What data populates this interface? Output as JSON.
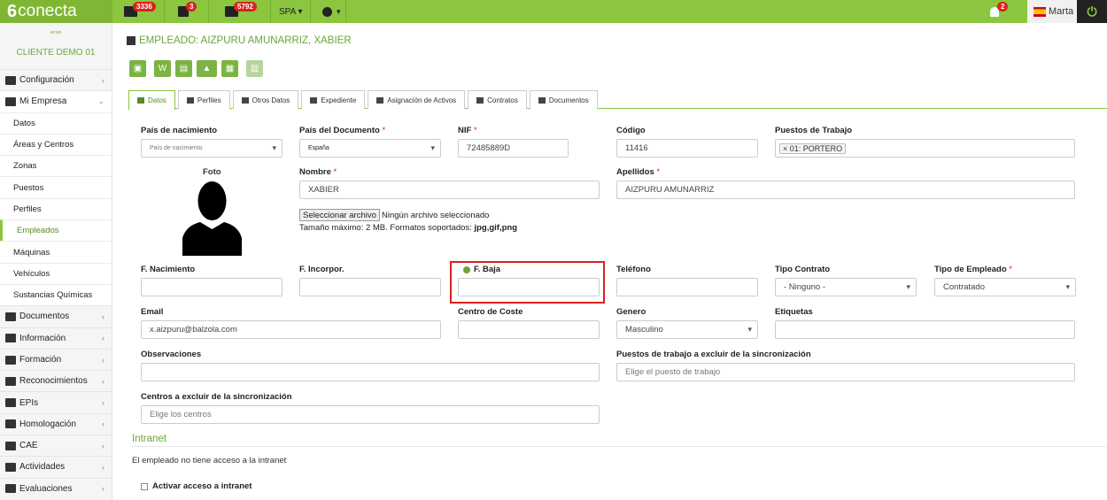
{
  "app": {
    "name": "conecta",
    "logo_mark": "6"
  },
  "topbar": {
    "mail_count": "3336",
    "calendar_count": "3",
    "tasks_count": "5792",
    "language": "SPA ▾",
    "help": "▾",
    "notifications_count": "2",
    "user_name": "Marta",
    "power": "⏻"
  },
  "sidebar": {
    "company_logo": "arrian",
    "client": "CLIENTE DEMO 01",
    "items": [
      {
        "label": "Configuración"
      },
      {
        "label": "Mi Empresa"
      },
      {
        "label": "Documentos"
      },
      {
        "label": "Información"
      },
      {
        "label": "Formación"
      },
      {
        "label": "Reconocimientos"
      },
      {
        "label": "EPIs"
      },
      {
        "label": "Homologación"
      },
      {
        "label": "CAE"
      },
      {
        "label": "Actividades"
      },
      {
        "label": "Evaluaciones"
      }
    ],
    "sub_items": [
      {
        "label": "Datos"
      },
      {
        "label": "Áreas y Centros"
      },
      {
        "label": "Zonas"
      },
      {
        "label": "Puestos"
      },
      {
        "label": "Perfiles"
      },
      {
        "label": "Empleados"
      },
      {
        "label": "Máquinas"
      },
      {
        "label": "Vehículos"
      },
      {
        "label": "Sustancias Químicas"
      }
    ]
  },
  "page": {
    "title": "EMPLEADO: AIZPURU AMUNARRIZ, XABIER"
  },
  "tabs": [
    {
      "label": "Datos"
    },
    {
      "label": "Perfiles"
    },
    {
      "label": "Otros Datos"
    },
    {
      "label": "Expediente"
    },
    {
      "label": "Asignación de Activos"
    },
    {
      "label": "Contratos"
    },
    {
      "label": "Documentos"
    }
  ],
  "form": {
    "pais_nacimiento": {
      "label": "País de nacimiento",
      "value": "País de nacimiento"
    },
    "pais_documento": {
      "label": "País del Documento",
      "value": "España"
    },
    "nif": {
      "label": "NIF",
      "value": "72485889D"
    },
    "codigo": {
      "label": "Código",
      "value": "11416"
    },
    "puestos": {
      "label": "Puestos de Trabajo",
      "tag": "× 01: PORTERO"
    },
    "foto": {
      "label": "Foto"
    },
    "nombre": {
      "label": "Nombre",
      "value": "XABIER"
    },
    "apellidos": {
      "label": "Apellidos",
      "value": "AIZPURU AMUNARRIZ"
    },
    "file": {
      "button": "Seleccionar archivo",
      "status": "Ningún archivo seleccionado",
      "help": "Tamaño máximo: 2 MB. Formatos soportados: ",
      "formats": "jpg,gif,png"
    },
    "f_nacimiento": {
      "label": "F. Nacimiento",
      "value": ""
    },
    "f_incorpor": {
      "label": "F. Incorpor.",
      "value": ""
    },
    "f_baja": {
      "label": "F. Baja",
      "value": ""
    },
    "telefono": {
      "label": "Teléfono",
      "value": ""
    },
    "tipo_contrato": {
      "label": "Tipo Contrato",
      "value": "- Ninguno -"
    },
    "tipo_empleado": {
      "label": "Tipo de Empleado",
      "value": "Contratado"
    },
    "email": {
      "label": "Email",
      "value": "x.aizpuru@balzola.com"
    },
    "centro_coste": {
      "label": "Centro de Coste",
      "value": ""
    },
    "genero": {
      "label": "Genero",
      "value": "Masculino"
    },
    "etiquetas": {
      "label": "Etiquetas",
      "value": ""
    },
    "observaciones": {
      "label": "Observaciones",
      "value": ""
    },
    "puestos_excluir": {
      "label": "Puestos de trabajo a excluir de la sincronización",
      "placeholder": "Elige el puesto de trabajo"
    },
    "centros_excluir": {
      "label": "Centros a excluir de la sincronización",
      "placeholder": "Elige los centros"
    },
    "required_mark": "*"
  },
  "intranet": {
    "title": "Intranet",
    "status": "El empleado no tiene acceso a la intranet",
    "checkbox_label": "Activar acceso a intranet"
  }
}
